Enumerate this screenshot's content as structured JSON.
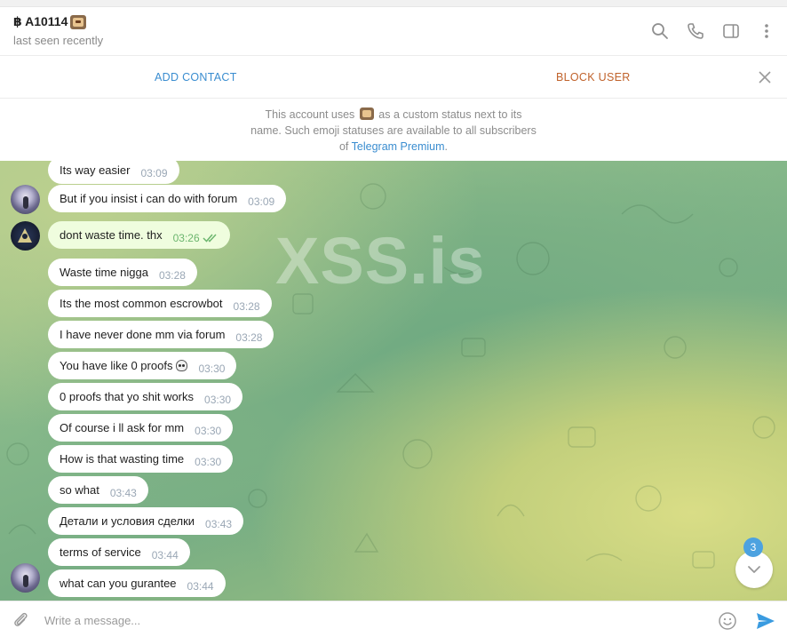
{
  "header": {
    "title": "฿ A10114",
    "status": "last seen recently",
    "icons": [
      "search-icon",
      "phone-icon",
      "sidebar-toggle-icon",
      "more-vertical-icon"
    ]
  },
  "action_bar": {
    "add_contact": "ADD CONTACT",
    "block_user": "BLOCK USER"
  },
  "notice": {
    "before_emoji": "This account uses",
    "after_emoji": "as a custom status next to its name. Such emoji statuses are available to all subscribers of",
    "link": "Telegram Premium",
    "end": "."
  },
  "watermark": "XSS.is",
  "messages": [
    {
      "text": "Its way easier",
      "time": "03:09",
      "own": false
    },
    {
      "text": "But if you insist i can do with forum",
      "time": "03:09",
      "own": false
    },
    {
      "text": "dont waste time. thx",
      "time": "03:26",
      "own": true
    },
    {
      "text": "Waste time nigga",
      "time": "03:28",
      "own": false
    },
    {
      "text": "Its the most common escrowbot",
      "time": "03:28",
      "own": false
    },
    {
      "text": "I have never done mm via forum",
      "time": "03:28",
      "own": false
    },
    {
      "text": "You have like 0 proofs",
      "time": "03:30",
      "own": false
    },
    {
      "text": "0 proofs that yo shit works",
      "time": "03:30",
      "own": false
    },
    {
      "text": "Of course i ll ask for mm",
      "time": "03:30",
      "own": false
    },
    {
      "text": "How is that wasting time",
      "time": "03:30",
      "own": false
    },
    {
      "text": "so what",
      "time": "03:43",
      "own": false
    },
    {
      "text": "Детали и условия сделки",
      "time": "03:43",
      "own": false
    },
    {
      "text": "terms of service",
      "time": "03:44",
      "own": false
    },
    {
      "text": "what can you gurantee",
      "time": "03:44",
      "own": false
    }
  ],
  "unread_count": "3",
  "composer": {
    "placeholder": "Write a message..."
  },
  "colors": {
    "link_blue": "#3a8dd0",
    "block_orange": "#c0622b",
    "own_bubble": "#effdde",
    "check_green": "#6cb66e",
    "badge_blue": "#4ca2e0"
  }
}
